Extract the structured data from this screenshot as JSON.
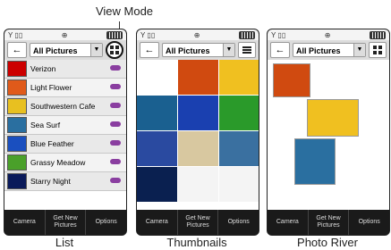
{
  "callout": "View Mode",
  "filter": "All Pictures",
  "softkeys": [
    "Camera",
    "Get New Pictures",
    "Options"
  ],
  "captions": [
    "List",
    "Thumbnails",
    "Photo River"
  ],
  "list_items": [
    {
      "name": "Verizon",
      "color": "#cc0000"
    },
    {
      "name": "Light Flower",
      "color": "#e05a1a"
    },
    {
      "name": "Southwestern Cafe",
      "color": "#e8c020"
    },
    {
      "name": "Sea Surf",
      "color": "#2a6fa0"
    },
    {
      "name": "Blue Feather",
      "color": "#1a4fbf"
    },
    {
      "name": "Grassy Meadow",
      "color": "#4aa02a"
    },
    {
      "name": "Starry Night",
      "color": "#0a1a5a"
    }
  ],
  "thumb_colors": [
    "#ffffff",
    "#d04a10",
    "#f0c020",
    "#1a6090",
    "#1a40b0",
    "#2a9a2a",
    "#2a4aa0",
    "#d8c8a0",
    "#3a70a0",
    "#0a2050",
    "#f4f4f4",
    "#f4f4f4"
  ],
  "river_cards": [
    "#d04a10",
    "#f0c020",
    "#2a6fa0"
  ],
  "statusbar_left": "Y ▯▯",
  "statusbar_mid": "⊕"
}
